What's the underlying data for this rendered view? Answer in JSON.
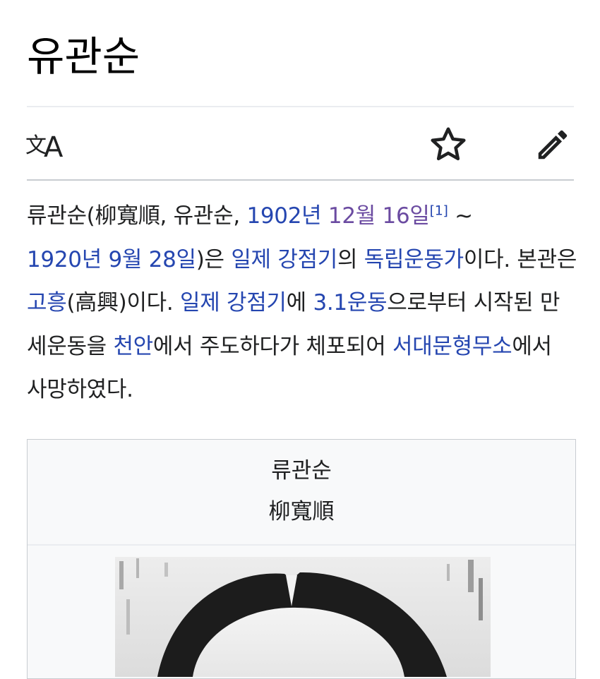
{
  "page": {
    "title": "유관순"
  },
  "toolbar": {
    "language_icon": "language-icon",
    "watch_icon": "star-icon",
    "edit_icon": "pencil-icon"
  },
  "lead": {
    "t1": "류관순(柳寬順, 유관순, ",
    "l_year_birth": "1902년",
    "s1": " ",
    "l_month_birth": "12월 16일",
    "ref": "[1]",
    "t2": " ~ ",
    "l_year_death": "1920년",
    "s2": " ",
    "l_date_death": "9월 28일",
    "t3": ")은 ",
    "l_era1": "일제 강점기",
    "t4": "의 ",
    "l_activist": "독립운동가",
    "t5": "이다. 본관은 ",
    "l_clan": "고흥",
    "t6": "(高興)이다. ",
    "l_era2": "일제 강점기",
    "t7": "에 ",
    "l_movement": "3.1운동",
    "t8": "으로부터 시작된 만세운동을 ",
    "l_city": "천안",
    "t9": "에서 주도하다가 체포되어 ",
    "l_prison": "서대문형무소",
    "t10": "에서 사망하였다."
  },
  "infobox": {
    "name": "류관순",
    "hanja": "柳寬順"
  },
  "colors": {
    "link": "#2546b0",
    "visited_link": "#6b4ba1",
    "text": "#202122",
    "infobox_bg": "#f8f9fa"
  }
}
